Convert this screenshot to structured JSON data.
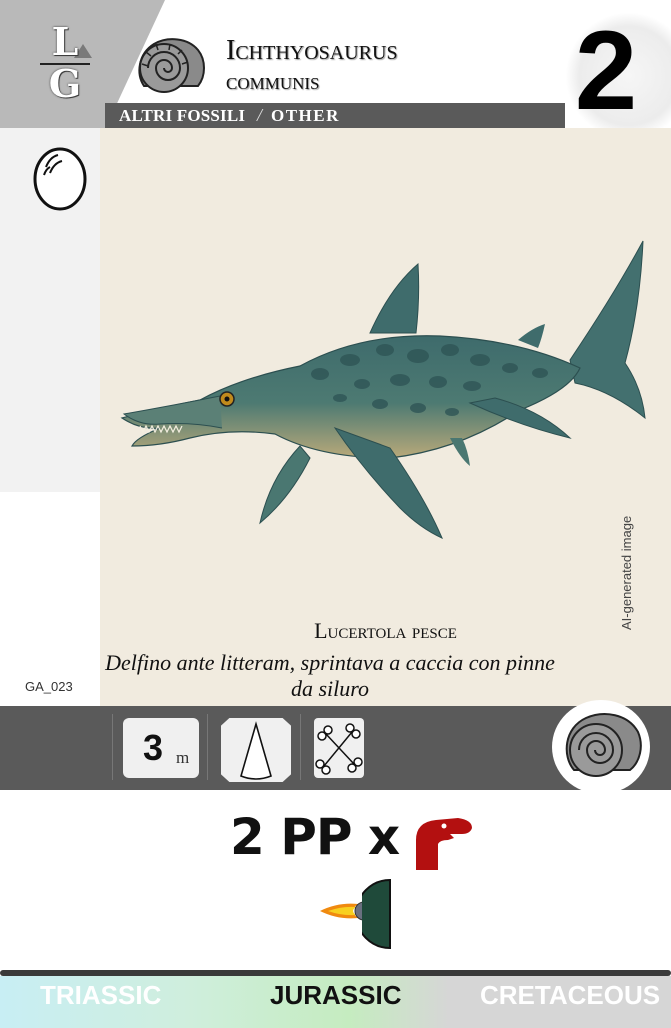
{
  "header": {
    "logo_top": "L",
    "logo_bottom": "G",
    "name_line1": "Ichthyosaurus",
    "name_line2": "communis",
    "category_it": "ALTRI FOSSILI",
    "category_separator": "/",
    "category_en": "OTHER",
    "cost": "2"
  },
  "card": {
    "code": "GA_023",
    "ai_notice": "AI-generated image",
    "common_name": "Lucertola pesce",
    "flavor_text": "Delfino ante litteram, sprintava a caccia con pinne da siluro"
  },
  "stats": {
    "size_value": "3",
    "size_unit": "m",
    "icons": [
      "tooth-icon",
      "bones-icon"
    ],
    "type_icon": "ammonite-icon"
  },
  "ability": {
    "text": "2 PP x",
    "icons": [
      "dinosaur-icon",
      "meteor-icon",
      "half-globe-icon"
    ],
    "colors": {
      "dinosaur": "#b31010",
      "globe": "#1f4a3a"
    }
  },
  "eras": {
    "items": [
      "TRIASSIC",
      "JURASSIC",
      "CRETACEOUS"
    ],
    "active": "JURASSIC"
  }
}
